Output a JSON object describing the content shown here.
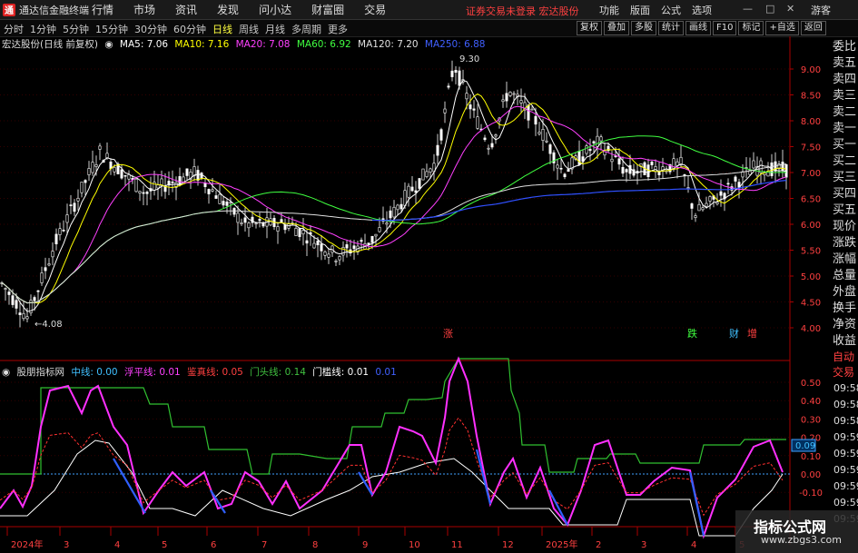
{
  "app": {
    "title": "通达信金融终端",
    "logo_char": "通"
  },
  "menu": [
    "行情",
    "市场",
    "资讯",
    "发现",
    "问小达",
    "财富圈",
    "交易"
  ],
  "notice": "证券交易未登录  宏达股份",
  "right_menu": [
    "功能",
    "版面",
    "公式",
    "选项"
  ],
  "guest": "游客",
  "periods": [
    "分时",
    "1分钟",
    "5分钟",
    "15分钟",
    "30分钟",
    "60分钟",
    "日线",
    "周线",
    "月线",
    "多周期",
    "更多"
  ],
  "active_period": "日线",
  "tools": [
    "复权",
    "叠加",
    "多股",
    "统计",
    "画线",
    "F10",
    "标记",
    "+自选",
    "返回"
  ],
  "main_legend": {
    "stock": "宏达股份(日线 前复权)",
    "ma5": "MA5: 7.06",
    "ma10": "MA10: 7.16",
    "ma20": "MA20: 7.08",
    "ma60": "MA60: 6.92",
    "ma120": "MA120: 7.20",
    "ma250": "MA250: 6.88"
  },
  "ind_legend": {
    "name": "股朋指标网",
    "l1": "中线: 0.00",
    "l2": "浮平线: 0.01",
    "l3": "鉴真线: 0.05",
    "l4": "门头线: 0.14",
    "l5": "门槛线: 0.01",
    "l6": "0.01"
  },
  "price_axis": [
    "9.00",
    "8.50",
    "8.00",
    "7.50",
    "7.00",
    "6.50",
    "6.00",
    "5.50",
    "5.00",
    "4.50",
    "4.00"
  ],
  "ind_axis": [
    "0.50",
    "0.40",
    "0.30",
    "0.20",
    "0.10",
    "0.00",
    "-0.10"
  ],
  "high_label": "9.30",
  "low_label": "4.08",
  "ind_value_badge": "0.09",
  "markers": {
    "zhang": "涨",
    "die": "跌",
    "cai": "财",
    "zeng": "增"
  },
  "x_axis": [
    "2024年",
    "3",
    "4",
    "5",
    "6",
    "7",
    "8",
    "9",
    "10",
    "11",
    "12",
    "2025年",
    "2",
    "3",
    "4",
    "5"
  ],
  "right_panel": [
    "委比",
    "卖五",
    "卖四",
    "卖三",
    "卖二",
    "卖一",
    "买一",
    "买二",
    "买三",
    "买四",
    "买五",
    "现价",
    "涨跌",
    "涨幅",
    "总量",
    "外盘",
    "换手",
    "净资",
    "收益"
  ],
  "right_panel2": [
    "自动",
    "交易"
  ],
  "right_times": [
    "09:58",
    "09:58",
    "09:58",
    "09:59",
    "09:59",
    "09:59",
    "09:59",
    "09:59",
    "09:59"
  ],
  "watermark": {
    "title": "指标公式网",
    "url": "www.zbgs3.com"
  }
}
